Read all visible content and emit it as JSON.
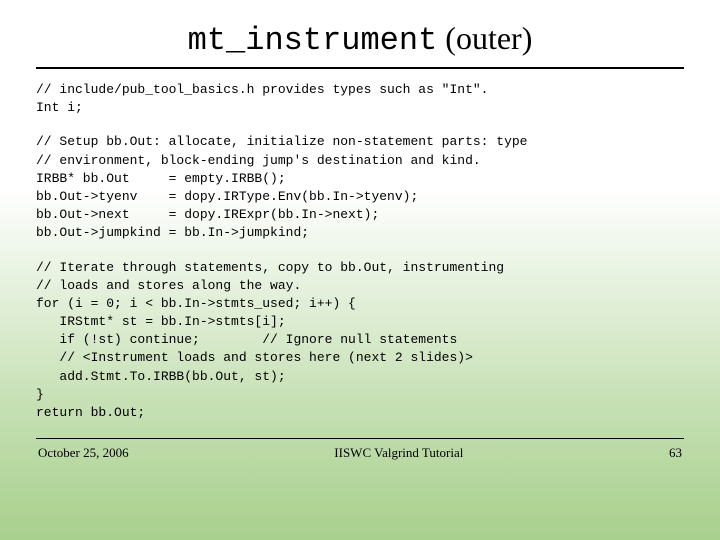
{
  "title_mono": "mt_instrument",
  "title_rest": " (outer)",
  "code_block1": "// include/pub_tool_basics.h provides types such as \"Int\".\nInt i;",
  "code_block2": "// Setup bb.Out: allocate, initialize non-statement parts: type\n// environment, block-ending jump's destination and kind.\nIRBB* bb.Out     = empty.IRBB();\nbb.Out->tyenv    = dopy.IRType.Env(bb.In->tyenv);\nbb.Out->next     = dopy.IRExpr(bb.In->next);\nbb.Out->jumpkind = bb.In->jumpkind;",
  "code_block3": "// Iterate through statements, copy to bb.Out, instrumenting\n// loads and stores along the way.\nfor (i = 0; i < bb.In->stmts_used; i++) {\n   IRStmt* st = bb.In->stmts[i];\n   if (!st) continue;        // Ignore null statements\n   // <Instrument loads and stores here (next 2 slides)>\n   add.Stmt.To.IRBB(bb.Out, st);\n}\nreturn bb.Out;",
  "footer_left": "October 25, 2006",
  "footer_center": "IISWC Valgrind Tutorial",
  "footer_right": "63"
}
